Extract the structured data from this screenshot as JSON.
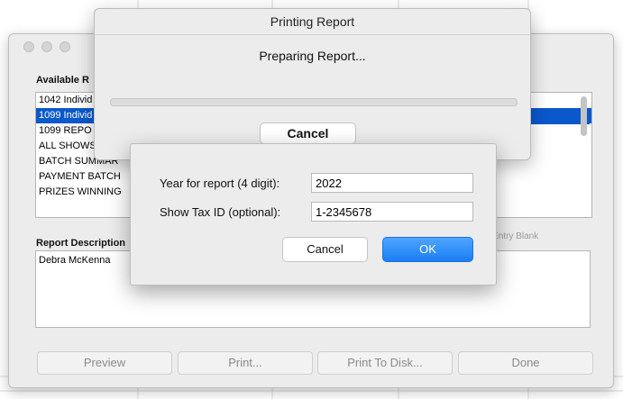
{
  "print_dialog": {
    "title": "Printing Report",
    "message": "Preparing Report...",
    "cancel_label": "Cancel"
  },
  "main_window": {
    "available_label": "Available R",
    "report_list": [
      "1042 Individ",
      "1099 Individ",
      "1099 REPO",
      "ALL SHOWS",
      "BATCH SUMMAR",
      "PAYMENT BATCH",
      "PRIZES WINNING"
    ],
    "selected_index": 1,
    "description_label": "Report Description",
    "description_text": "Debra McKenna",
    "entry_blank_hint": "r Entry Blank",
    "buttons": {
      "preview": "Preview",
      "print": "Print...",
      "print_to_disk": "Print To Disk...",
      "done": "Done"
    }
  },
  "tax_dialog": {
    "year_label": "Year for report (4 digit):",
    "year_value": "2022",
    "taxid_label": "Show Tax ID (optional):",
    "taxid_value": "1-2345678",
    "cancel_label": "Cancel",
    "ok_label": "OK"
  },
  "colors": {
    "selection": "#0a58ca",
    "ok_button": "#1a7ef5"
  }
}
